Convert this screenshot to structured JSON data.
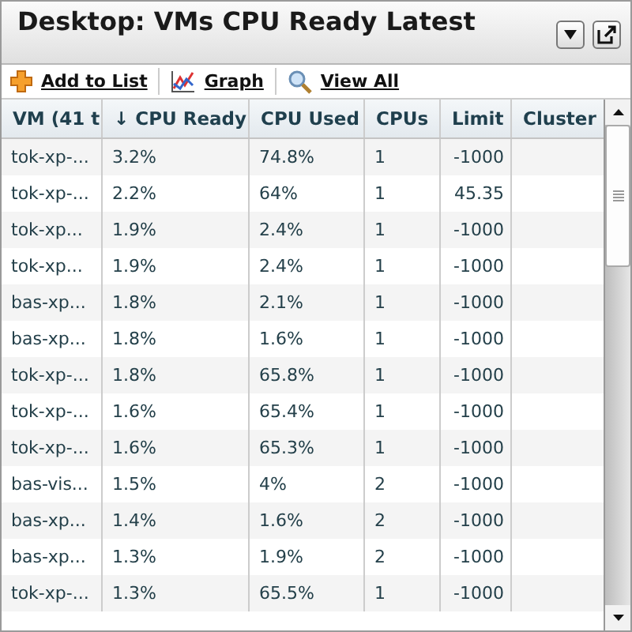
{
  "title": "Desktop: VMs CPU Ready Latest",
  "toolbar": [
    {
      "kind": "add",
      "label": "Add to List"
    },
    {
      "kind": "graph",
      "label": "Graph"
    },
    {
      "kind": "search",
      "label": "View All"
    }
  ],
  "table": {
    "columns": [
      {
        "label": "VM (41 t"
      },
      {
        "label": "↓ CPU Ready"
      },
      {
        "label": "CPU Used"
      },
      {
        "label": "CPUs"
      },
      {
        "label": "Limit"
      },
      {
        "label": "Cluster"
      }
    ],
    "rows": [
      [
        "tok-xp-...",
        "3.2%",
        "74.8%",
        "1",
        "-1000"
      ],
      [
        "tok-xp-...",
        "2.2%",
        "64%",
        "1",
        "45.35"
      ],
      [
        "tok-xp...",
        "1.9%",
        "2.4%",
        "1",
        "-1000"
      ],
      [
        "tok-xp...",
        "1.9%",
        "2.4%",
        "1",
        "-1000"
      ],
      [
        "bas-xp...",
        "1.8%",
        "2.1%",
        "1",
        "-1000"
      ],
      [
        "bas-xp...",
        "1.8%",
        "1.6%",
        "1",
        "-1000"
      ],
      [
        "tok-xp-...",
        "1.8%",
        "65.8%",
        "1",
        "-1000"
      ],
      [
        "tok-xp-...",
        "1.6%",
        "65.4%",
        "1",
        "-1000"
      ],
      [
        "tok-xp-...",
        "1.6%",
        "65.3%",
        "1",
        "-1000"
      ],
      [
        "bas-vis...",
        "1.5%",
        "4%",
        "2",
        "-1000"
      ],
      [
        "bas-xp...",
        "1.4%",
        "1.6%",
        "2",
        "-1000"
      ],
      [
        "bas-xp...",
        "1.3%",
        "1.9%",
        "2",
        "-1000"
      ],
      [
        "tok-xp-...",
        "1.3%",
        "65.5%",
        "1",
        "-1000"
      ]
    ]
  }
}
